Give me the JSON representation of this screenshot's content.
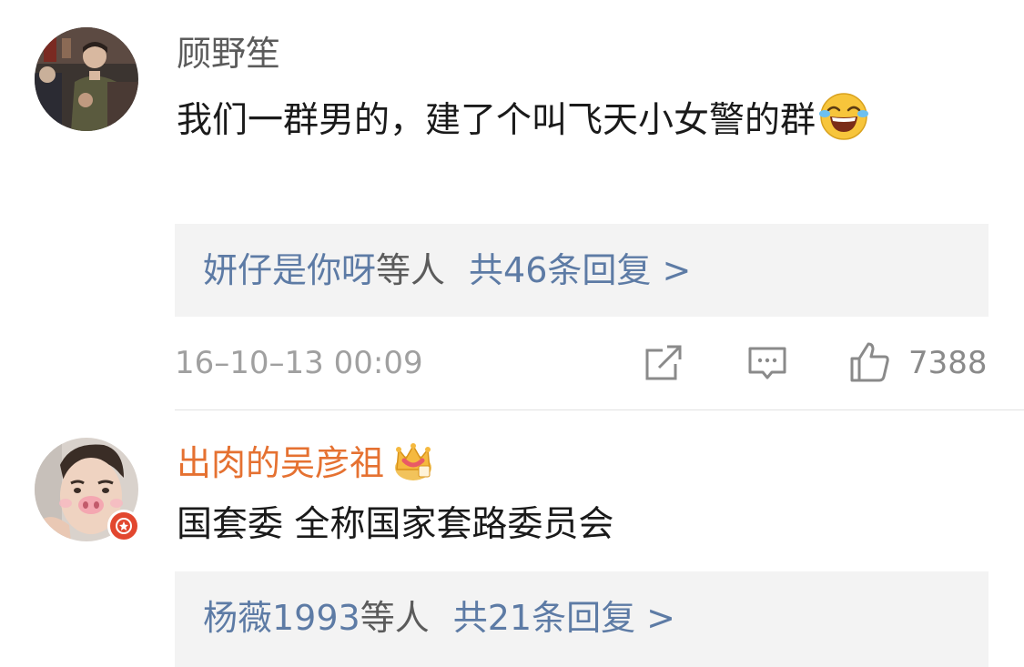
{
  "comments": [
    {
      "username": "顾野笙",
      "content": "我们一群男的，建了个叫飞天小女警的群",
      "content_emoji": "laughing-tears-emoji",
      "replies": {
        "names": "妍仔是你呀",
        "suffix": "等人",
        "count": "共46条回复 >"
      },
      "timestamp": "16–10–13 00:09",
      "likes": "7388",
      "actions": [
        "share-icon",
        "comment-icon",
        "like-icon"
      ]
    },
    {
      "username": "出肉的吴彦祖",
      "badge": "crown-icon",
      "content": "国套委 全称国家套路委员会",
      "replies": {
        "names": "杨薇1993",
        "suffix": "等人",
        "count": "共21条回复 >"
      }
    }
  ],
  "colors": {
    "link_blue": "#5d7ba5",
    "vip_orange": "#e57131",
    "reply_bg": "#f3f3f3"
  }
}
